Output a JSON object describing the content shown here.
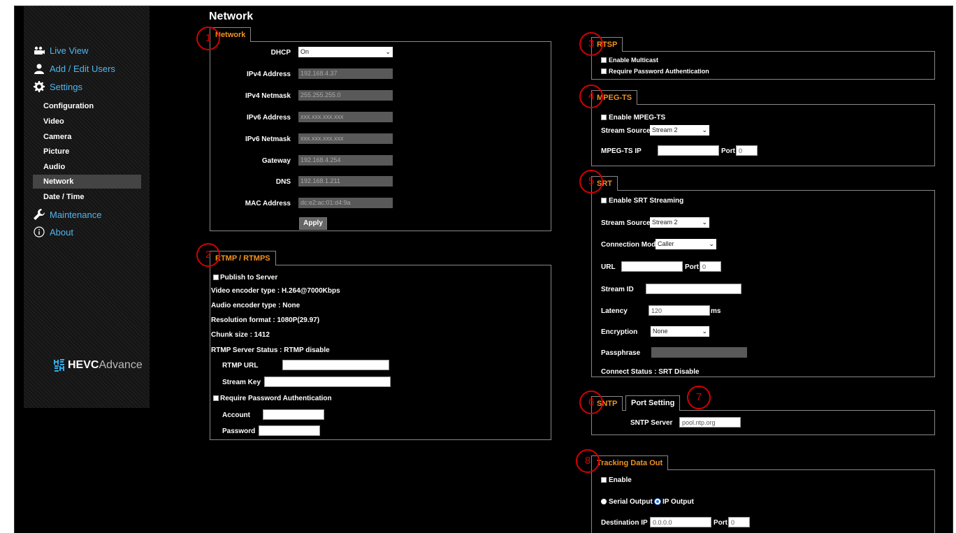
{
  "page_title": "Network",
  "sidebar": {
    "live_view": "Live View",
    "add_edit_users": "Add / Edit Users",
    "settings": "Settings",
    "sub_items": [
      "Configuration",
      "Video",
      "Camera",
      "Picture",
      "Audio",
      "Network",
      "Date / Time"
    ],
    "active_item": "Network",
    "maintenance": "Maintenance",
    "about": "About",
    "logo_text_bold": "HEVC",
    "logo_text_light": "Advance"
  },
  "network": {
    "tab": "Network",
    "dhcp_label": "DHCP",
    "dhcp_value": "On",
    "ipv4_address_label": "IPv4 Address",
    "ipv4_address": "192.168.4.37",
    "ipv4_netmask_label": "IPv4 Netmask",
    "ipv4_netmask": "255.255.255.0",
    "ipv6_address_label": "IPv6 Address",
    "ipv6_address": "xxx.xxx.xxx.xxx",
    "ipv6_netmask_label": "IPv6 Netmask",
    "ipv6_netmask": "xxx.xxx.xxx.xxx",
    "gateway_label": "Gateway",
    "gateway": "192.168.4.254",
    "dns_label": "DNS",
    "dns": "192.168.1.211",
    "mac_label": "MAC Address",
    "mac": "dc:e2:ac:01:d4:9a",
    "apply": "Apply"
  },
  "rtmp": {
    "tab": "RTMP / RTMPS",
    "publish": "Publish to Server",
    "video_encoder": "Video encoder type : H.264@7000Kbps",
    "audio_encoder": "Audio encoder type : None",
    "resolution": "Resolution format : 1080P(29.97)",
    "chunk": "Chunk size : 1412",
    "status": "RTMP Server Status : RTMP disable",
    "url_label": "RTMP URL",
    "key_label": "Stream Key",
    "require_pw": "Require Password Authentication",
    "account_label": "Account",
    "password_label": "Password"
  },
  "rtsp": {
    "tab": "RTSP",
    "multicast": "Enable Multicast",
    "require_pw": "Require Password Authentication"
  },
  "mpegts": {
    "tab": "MPEG-TS",
    "enable": "Enable MPEG-TS",
    "source_label": "Stream Source",
    "source_value": "Stream 2",
    "ip_label": "MPEG-TS IP",
    "port_label": "Port",
    "port_value": "0"
  },
  "srt": {
    "tab": "SRT",
    "enable": "Enable SRT Streaming",
    "source_label": "Stream Source",
    "source_value": "Stream 2",
    "mode_label": "Connection Mode",
    "mode_value": "Caller",
    "url_label": "URL",
    "port_label": "Port",
    "port_value": "0",
    "stream_id_label": "Stream ID",
    "latency_label": "Latency",
    "latency_value": "120",
    "latency_unit": "ms",
    "encryption_label": "Encryption",
    "encryption_value": "None",
    "passphrase_label": "Passphrase",
    "status": "Connect Status : SRT Disable"
  },
  "sntp": {
    "tab_sntp": "SNTP",
    "tab_port": "Port Setting",
    "server_label": "SNTP Server",
    "server_value": "pool.ntp.org"
  },
  "tracking": {
    "tab": "Tracking Data Out",
    "enable": "Enable",
    "serial": "Serial Output",
    "ip": "IP Output",
    "dest_label": "Destination IP",
    "dest_value": "0.0.0.0",
    "port_label": "Port",
    "port_value": "0"
  },
  "callouts": [
    "1",
    "2",
    "3",
    "4",
    "5",
    "6",
    "7",
    "8"
  ],
  "colors": {
    "tab_orange": "#f3931e",
    "nav_blue": "#4fb7f0",
    "callout_red": "#d40000",
    "background": "#000000"
  }
}
